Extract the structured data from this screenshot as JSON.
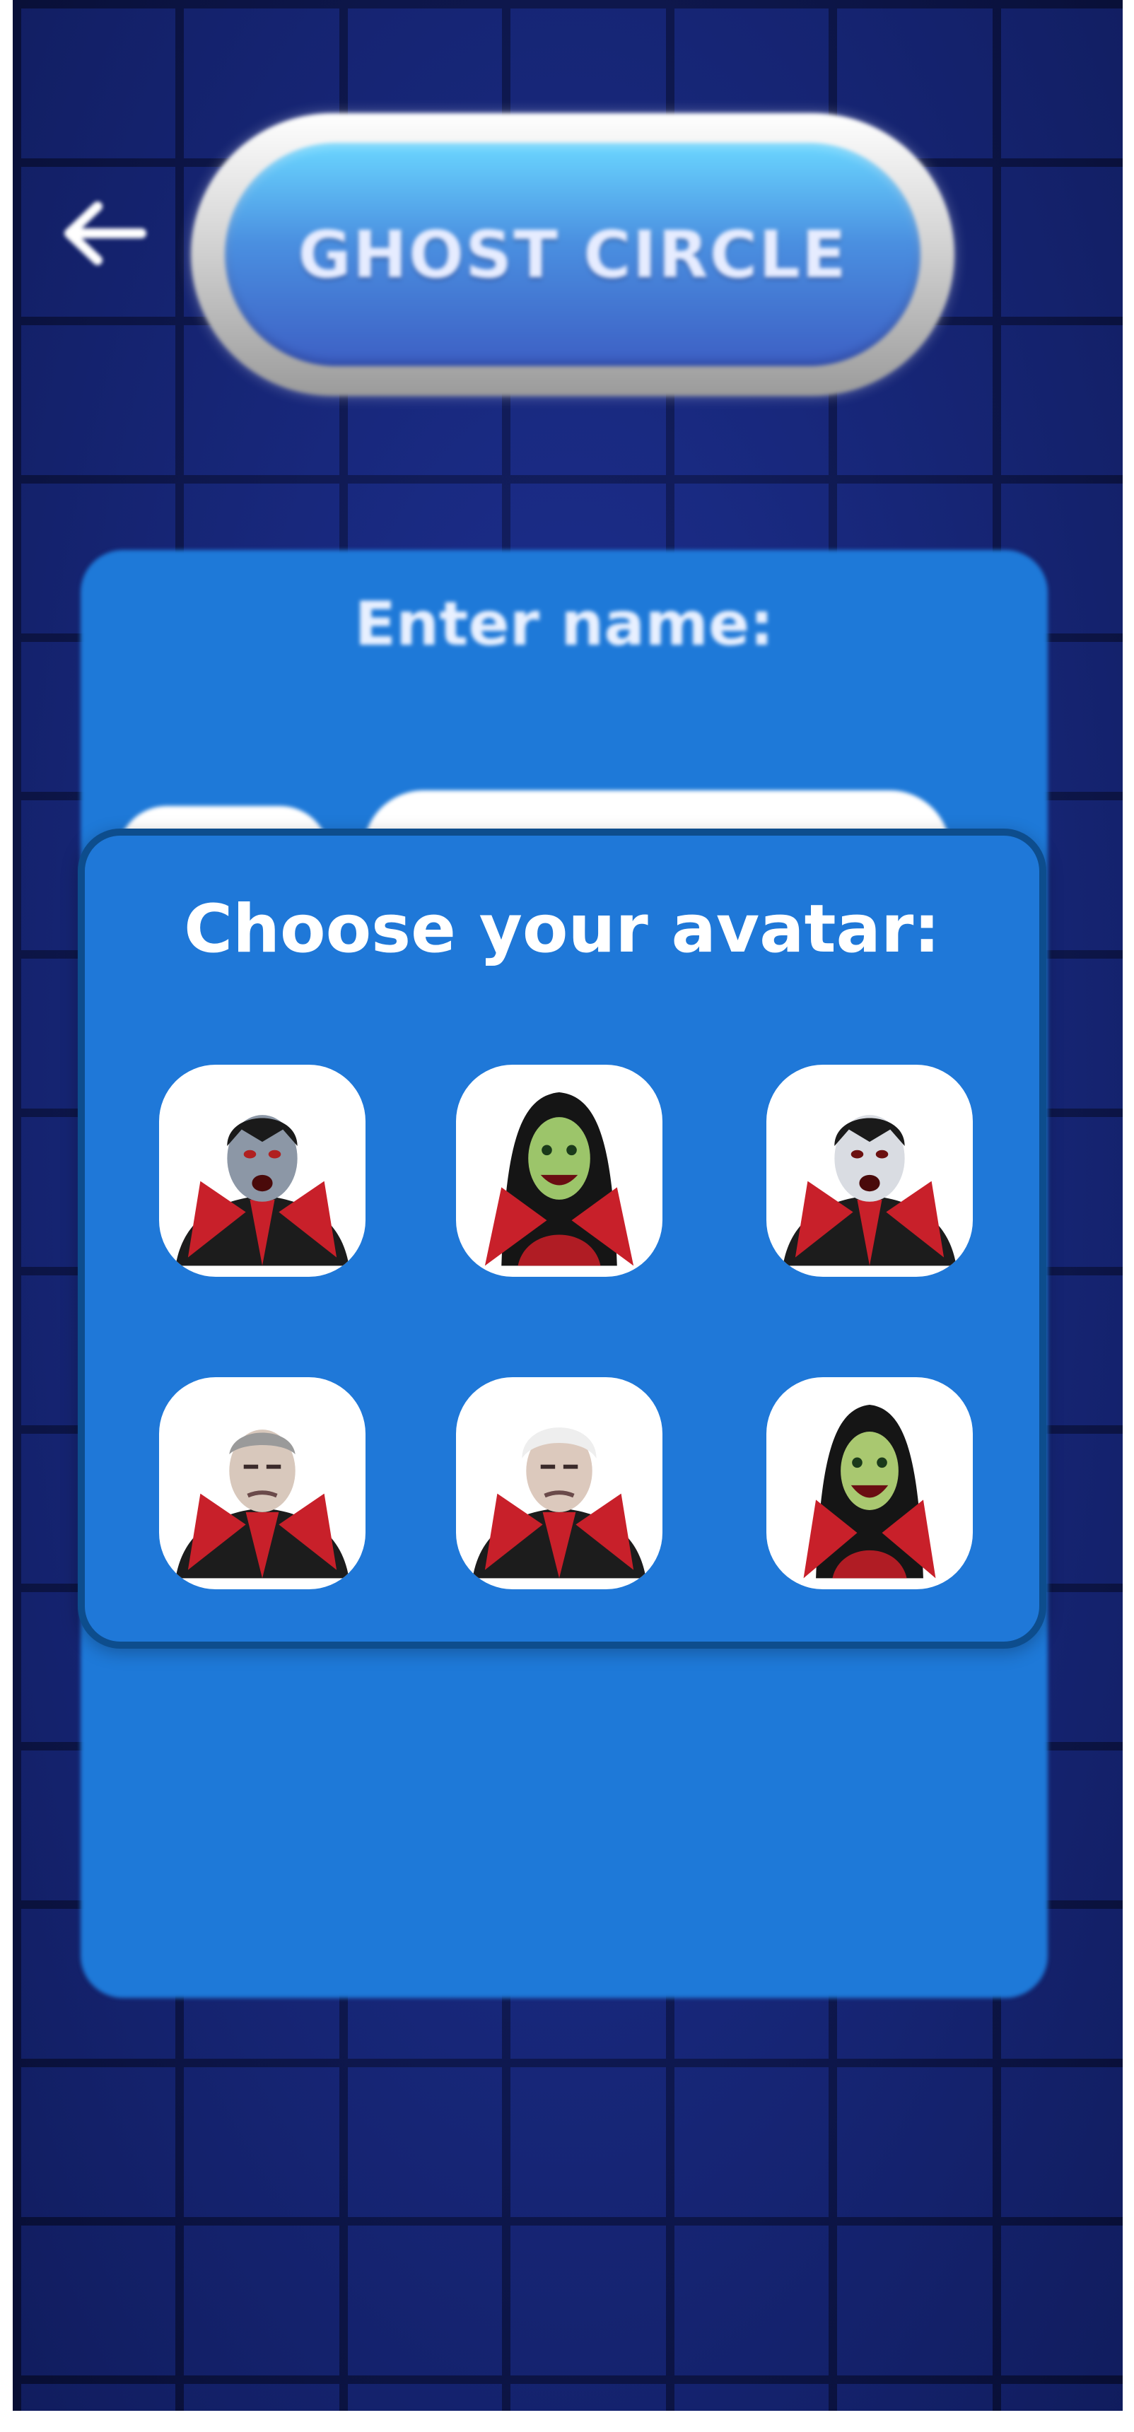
{
  "header": {
    "back_icon": "arrow-left-icon",
    "title": "GHOST CIRCLE"
  },
  "name_form": {
    "label": "Enter name:",
    "input_value": "",
    "avatar_button_icon": "avatar-icon"
  },
  "avatar_picker": {
    "title": "Choose your avatar:",
    "avatars": [
      {
        "id": "vampire-gray-fanged",
        "icon": "vampire-avatar-icon"
      },
      {
        "id": "vampire-woman-green",
        "icon": "vampire-woman-avatar-icon"
      },
      {
        "id": "vampire-pale-fanged",
        "icon": "vampire-avatar-icon"
      },
      {
        "id": "vampire-old-gray-hair",
        "icon": "old-vampire-avatar-icon"
      },
      {
        "id": "vampire-old-white-hair",
        "icon": "old-vampire-avatar-icon"
      },
      {
        "id": "vampire-woman-smiling",
        "icon": "vampire-woman-avatar-icon"
      }
    ]
  },
  "colors": {
    "brick_background": "#16267a",
    "card_blue": "#1e79d8",
    "modal_border": "#0d4d8d",
    "cape_red": "#c8202a",
    "tile_white": "#ffffff"
  }
}
